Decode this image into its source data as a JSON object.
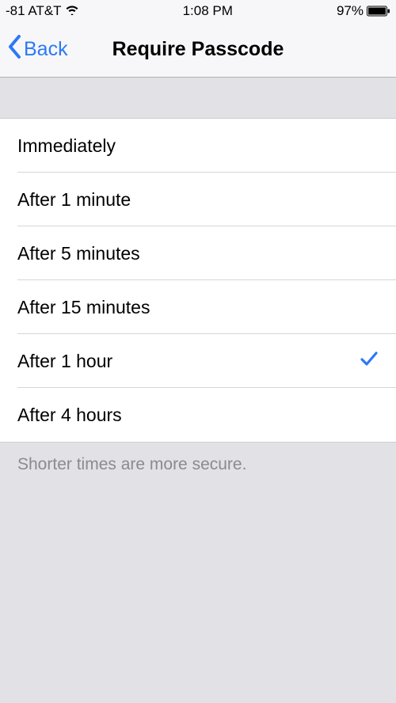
{
  "statusBar": {
    "signal": "-81 AT&T",
    "time": "1:08 PM",
    "batteryPercent": "97%"
  },
  "navBar": {
    "backLabel": "Back",
    "title": "Require Passcode"
  },
  "options": [
    {
      "label": "Immediately",
      "selected": false
    },
    {
      "label": "After 1 minute",
      "selected": false
    },
    {
      "label": "After 5 minutes",
      "selected": false
    },
    {
      "label": "After 15 minutes",
      "selected": false
    },
    {
      "label": "After 1 hour",
      "selected": true
    },
    {
      "label": "After 4 hours",
      "selected": false
    }
  ],
  "footer": "Shorter times are more secure.",
  "colors": {
    "accent": "#2c79f5",
    "checkmark": "#2c79f5"
  }
}
